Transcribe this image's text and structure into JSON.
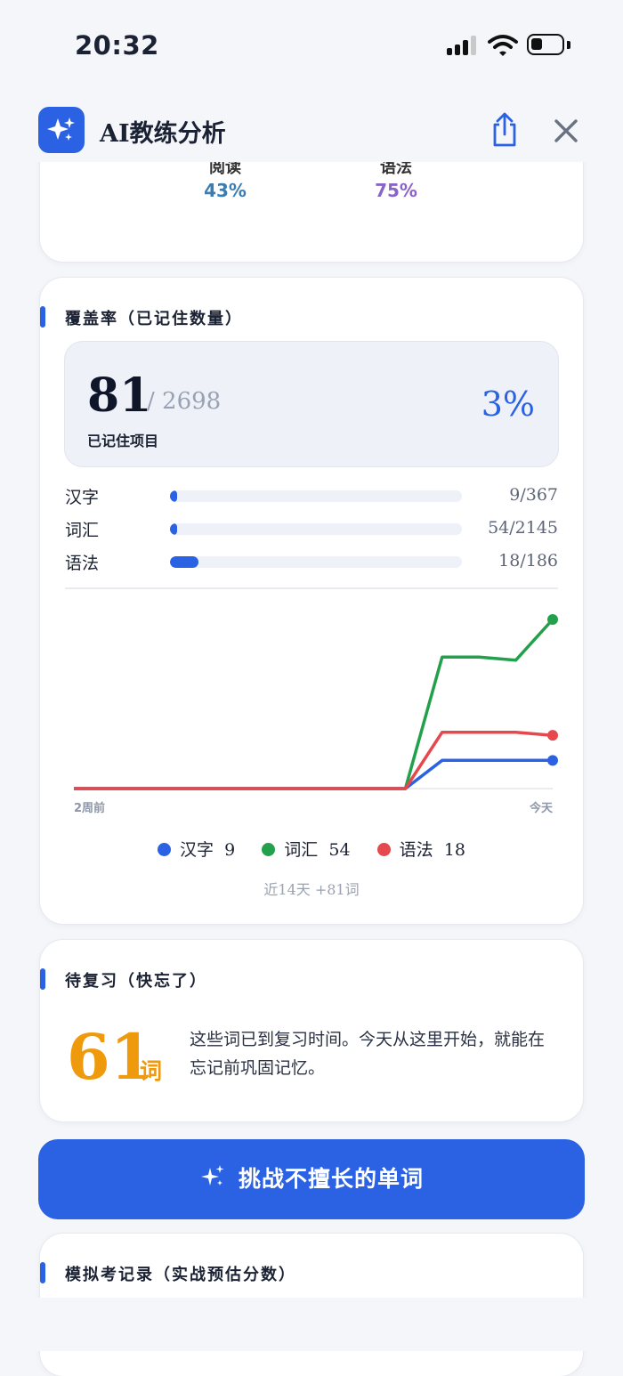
{
  "status_bar": {
    "time": "20:32"
  },
  "header": {
    "title": "AI教练分析",
    "icons": {
      "logo": "sparkle-icon",
      "share": "share-icon",
      "close": "close-icon"
    }
  },
  "skills": [
    {
      "name": "阅读",
      "value": "43%",
      "color": "#3b7db3"
    },
    {
      "name": "语法",
      "value": "75%",
      "color": "#8a63c9"
    }
  ],
  "coverage": {
    "title": "覆盖率（已记住数量）",
    "count": "81",
    "total": "/ 2698",
    "label": "已记住项目",
    "percent": "3%",
    "rows": [
      {
        "label": "汉字",
        "count": "9/367",
        "fraction": 0.0245
      },
      {
        "label": "词汇",
        "count": "54/2145",
        "fraction": 0.0252
      },
      {
        "label": "语法",
        "count": "18/186",
        "fraction": 0.0968
      }
    ],
    "footnote": "近14天 +81词"
  },
  "chart_data": {
    "type": "line",
    "x": [
      1,
      2,
      3,
      4,
      5,
      6,
      7,
      8,
      9,
      10,
      11,
      12,
      13,
      14
    ],
    "x_tick_labels": {
      "start": "2周前",
      "end": "今天"
    },
    "series": [
      {
        "name": "汉字",
        "color": "#2b62e3",
        "values": [
          0,
          0,
          0,
          0,
          0,
          0,
          0,
          0,
          0,
          0,
          9,
          9,
          9,
          9
        ],
        "legend_value": "9"
      },
      {
        "name": "词汇",
        "color": "#22a04b",
        "values": [
          0,
          0,
          0,
          0,
          0,
          0,
          0,
          0,
          0,
          0,
          42,
          42,
          41,
          54
        ],
        "legend_value": "54"
      },
      {
        "name": "语法",
        "color": "#e5484d",
        "values": [
          0,
          0,
          0,
          0,
          0,
          0,
          0,
          0,
          0,
          0,
          18,
          18,
          18,
          17
        ],
        "legend_value": "18"
      }
    ],
    "ylim": [
      0,
      54
    ],
    "grid": false,
    "legend": "bottom"
  },
  "review": {
    "title": "待复习（快忘了）",
    "count": "61",
    "unit": "词",
    "text": "这些词已到复习时间。今天从这里开始，就能在忘记前巩固记忆。"
  },
  "cta": {
    "label": "挑战不擅长的单词",
    "icon": "sparkle-icon"
  },
  "mock_exam": {
    "title": "模拟考记录（实战预估分数）"
  }
}
